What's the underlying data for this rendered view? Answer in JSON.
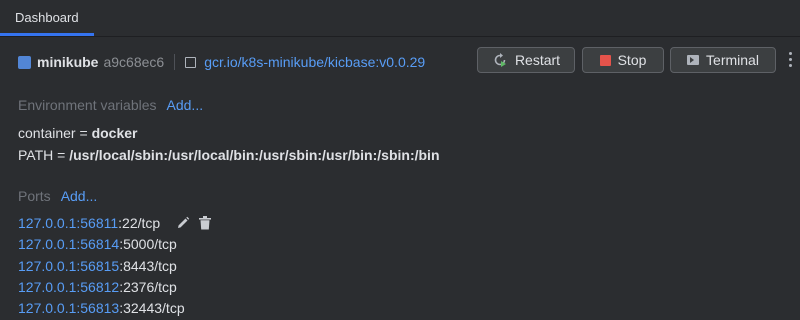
{
  "tab": {
    "label": "Dashboard"
  },
  "container": {
    "name": "minikube",
    "id": "a9c68ec6",
    "image": "gcr.io/k8s-minikube/kicbase:v0.0.29"
  },
  "actions": {
    "restart": "Restart",
    "stop": "Stop",
    "terminal": "Terminal"
  },
  "env": {
    "title": "Environment variables",
    "add": "Add...",
    "items": [
      {
        "key": "container",
        "sep": " = ",
        "value": "docker"
      },
      {
        "key": "PATH",
        "sep": " = ",
        "value": "/usr/local/sbin:/usr/local/bin:/usr/sbin:/usr/bin:/sbin:/bin"
      }
    ]
  },
  "ports": {
    "title": "Ports",
    "add": "Add...",
    "items": [
      {
        "host": "127.0.0.1:56811",
        "target": ":22/tcp"
      },
      {
        "host": "127.0.0.1:56814",
        "target": ":5000/tcp"
      },
      {
        "host": "127.0.0.1:56815",
        "target": ":8443/tcp"
      },
      {
        "host": "127.0.0.1:56812",
        "target": ":2376/tcp"
      },
      {
        "host": "127.0.0.1:56813",
        "target": ":32443/tcp"
      }
    ]
  },
  "colors": {
    "background": "#2b2d30",
    "accent": "#3574f0",
    "link": "#589df6",
    "stop": "#e5534b",
    "restart": "#5fb865"
  },
  "icons": {
    "restart": "restart-icon",
    "stop": "stop-icon",
    "terminal": "terminal-icon",
    "edit": "pencil-icon",
    "delete": "trash-icon",
    "more": "kebab-menu-icon"
  }
}
